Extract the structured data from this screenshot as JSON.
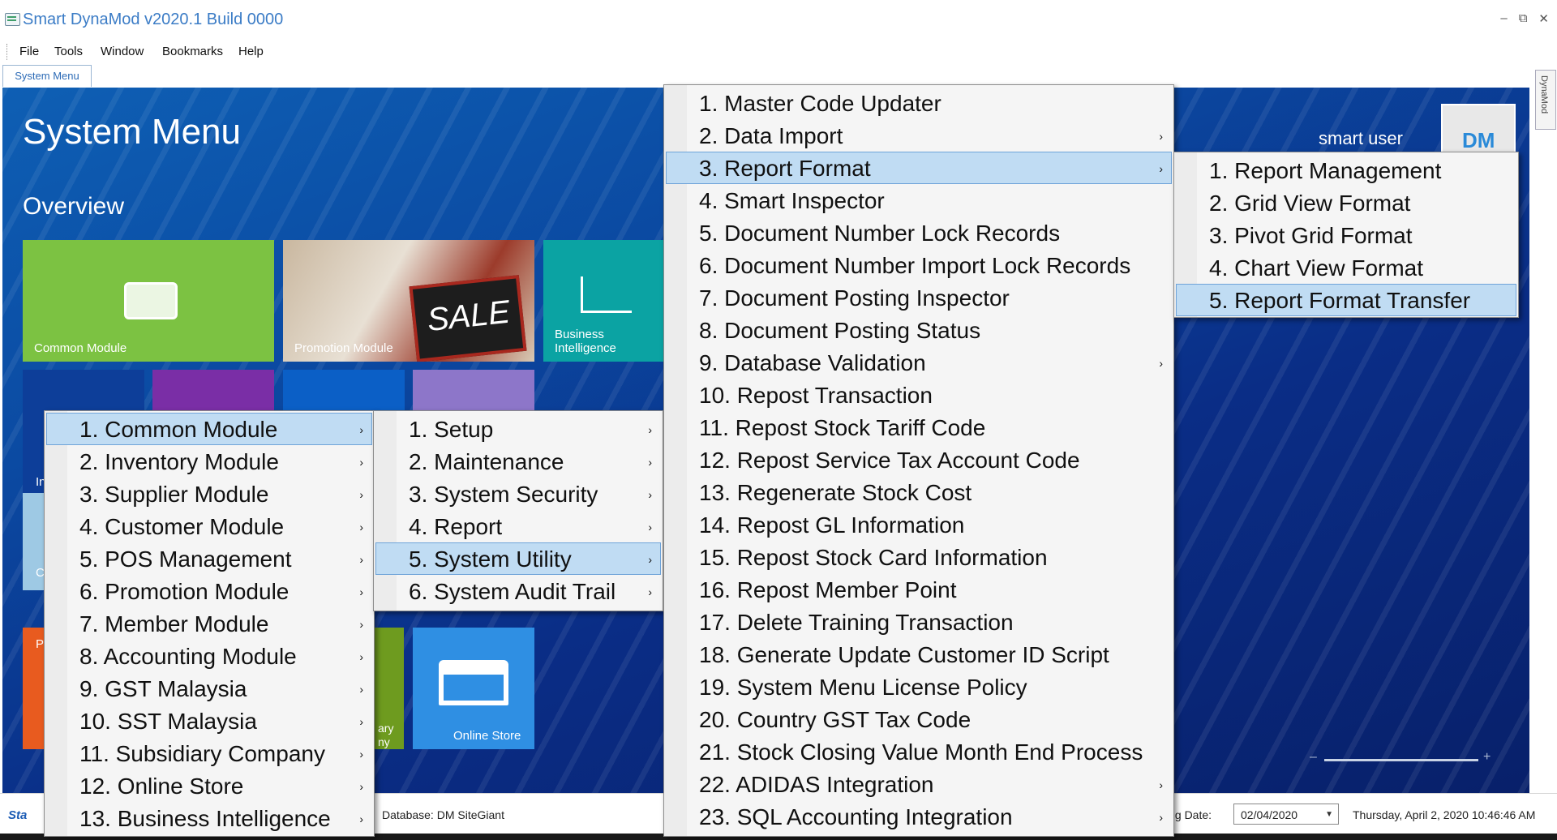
{
  "window": {
    "title": "Smart DynaMod v2020.1 Build 0000",
    "controls": [
      "–",
      "⧉",
      "✕"
    ]
  },
  "menubar": [
    "File",
    "Tools",
    "Window",
    "Bookmarks",
    "Help"
  ],
  "tab": "System Menu",
  "side_tab": "DynaMod",
  "dashboard": {
    "title": "System Menu",
    "subtitle": "Overview",
    "user": "smart user",
    "tiles": {
      "common": "Common Module",
      "promotion": "Promotion Module",
      "sale_sign": "SALE",
      "bi": "Business Intelligence",
      "inv_partial": "In",
      "c_partial": "C",
      "p_partial": "P",
      "subsidiary_partial": "ary\nny",
      "online": "Online Store"
    },
    "slider_minus": "–",
    "slider_plus": "+"
  },
  "status": {
    "logo": "Sta",
    "database": "Database: DM SiteGiant",
    "posting_label": "ing Date:",
    "date_value": "02/04/2020",
    "clock": "Thursday, April 2, 2020 10:46:46 AM"
  },
  "menus": {
    "main": [
      "1. Common Module",
      "2. Inventory Module",
      "3. Supplier Module",
      "4. Customer Module",
      "5. POS Management",
      "6. Promotion Module",
      "7. Member Module",
      "8. Accounting Module",
      "9. GST Malaysia",
      "10. SST Malaysia",
      "11. Subsidiary Company",
      "12. Online Store",
      "13. Business Intelligence"
    ],
    "common": [
      "1. Setup",
      "2. Maintenance",
      "3. System Security",
      "4. Report",
      "5. System Utility",
      "6. System Audit Trail"
    ],
    "utility": [
      "1. Master Code Updater",
      "2. Data Import",
      "3. Report Format",
      "4. Smart Inspector",
      "5. Document Number Lock Records",
      "6. Document Number Import Lock Records",
      "7. Document Posting Inspector",
      "8. Document Posting Status",
      "9. Database Validation",
      "10. Repost Transaction",
      "11. Repost Stock Tariff Code",
      "12. Repost Service Tax Account Code",
      "13. Regenerate Stock Cost",
      "14. Repost GL Information",
      "15. Repost Stock Card Information",
      "16. Repost Member Point",
      "17. Delete Training Transaction",
      "18. Generate Update Customer ID Script",
      "19. System Menu License Policy",
      "20. Country GST Tax Code",
      "21. Stock Closing Value Month End Process",
      "22. ADIDAS Integration",
      "23. SQL Accounting Integration"
    ],
    "report_format": [
      "1. Report Management",
      "2. Grid View Format",
      "3. Pivot Grid Format",
      "4. Chart View Format",
      "5. Report Format Transfer"
    ],
    "arrow": "›"
  }
}
